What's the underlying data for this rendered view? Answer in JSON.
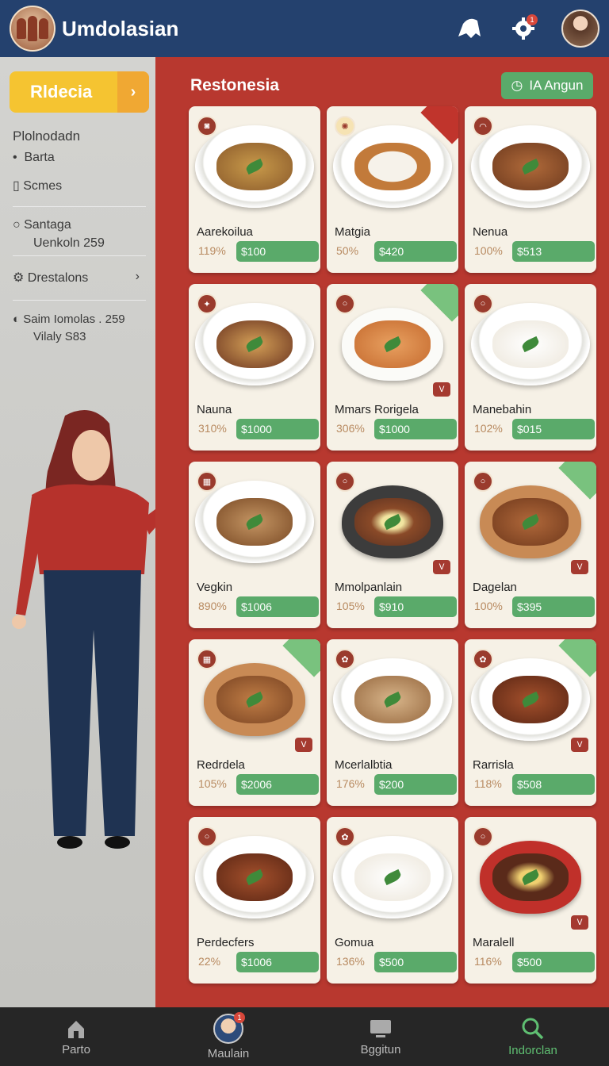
{
  "header": {
    "title": "Umdolasian",
    "notification_count": "1"
  },
  "sidebar": {
    "primary_button": "Rldecia",
    "heading": "Plolnodadn",
    "items": [
      {
        "label": "Barta"
      },
      {
        "label": "Scmes"
      },
      {
        "label": "Santaga"
      },
      {
        "label": "Uenkoln 259"
      },
      {
        "label": "Drestalons"
      },
      {
        "label": "Saim Iomolas . 259"
      },
      {
        "label": "Vilaly S83"
      }
    ]
  },
  "main": {
    "section_title": "Restonesia",
    "action_button": "IA Angun",
    "cards": [
      {
        "name": "Aarekoilua",
        "pct": "119%",
        "price": "$100"
      },
      {
        "name": "Matgia",
        "pct": "50%",
        "price": "$420"
      },
      {
        "name": "Nenua",
        "pct": "100%",
        "price": "$513"
      },
      {
        "name": "Nauna",
        "pct": "310%",
        "price": "$1000"
      },
      {
        "name": "Mmars Rorigela",
        "pct": "306%",
        "price": "$1000"
      },
      {
        "name": "Manebahin",
        "pct": "102%",
        "price": "$015"
      },
      {
        "name": "Vegkin",
        "pct": "890%",
        "price": "$1006"
      },
      {
        "name": "Mmolpanlain",
        "pct": "105%",
        "price": "$910"
      },
      {
        "name": "Dagelan",
        "pct": "100%",
        "price": "$395"
      },
      {
        "name": "Redrdela",
        "pct": "105%",
        "price": "$2006"
      },
      {
        "name": "Mcerlalbtia",
        "pct": "176%",
        "price": "$200"
      },
      {
        "name": "Rarrisla",
        "pct": "118%",
        "price": "$508"
      },
      {
        "name": "Perdecfers",
        "pct": "22%",
        "price": "$1006"
      },
      {
        "name": "Gomua",
        "pct": "136%",
        "price": "$500"
      },
      {
        "name": "Maralell",
        "pct": "116%",
        "price": "$500"
      }
    ]
  },
  "bottom_nav": {
    "items": [
      {
        "label": "Parto"
      },
      {
        "label": "Maulain"
      },
      {
        "label": "Bggitun"
      },
      {
        "label": "Indorclan"
      }
    ],
    "badge": "1"
  },
  "colors": {
    "header": "#24416e",
    "accent_green": "#5aaa6a",
    "main_bg": "#b8382f",
    "primary_yellow": "#f5c431"
  }
}
